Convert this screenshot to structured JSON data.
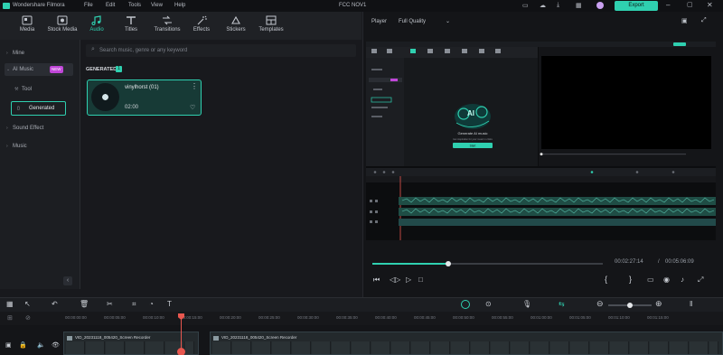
{
  "titlebar": {
    "app_name": "Wondershare Filmora",
    "menus": [
      "File",
      "Edit",
      "Tools",
      "View",
      "Help"
    ],
    "project_name": "FCC NOV1",
    "export_label": "Export"
  },
  "toolbar": {
    "tabs": [
      {
        "label": "Media",
        "icon": "media-icon"
      },
      {
        "label": "Stock Media",
        "icon": "stock-media-icon"
      },
      {
        "label": "Audio",
        "icon": "music-note-icon",
        "active": true
      },
      {
        "label": "Titles",
        "icon": "titles-icon"
      },
      {
        "label": "Transitions",
        "icon": "transitions-icon"
      },
      {
        "label": "Effects",
        "icon": "effects-icon"
      },
      {
        "label": "Stickers",
        "icon": "stickers-icon"
      },
      {
        "label": "Templates",
        "icon": "templates-icon"
      }
    ]
  },
  "sidebar": {
    "items": [
      {
        "label": "Mine"
      },
      {
        "label": "AI Music",
        "badge": "NEW"
      },
      {
        "label": "Tool"
      },
      {
        "label": "Generated"
      },
      {
        "label": "Sound Effect"
      },
      {
        "label": "Music"
      }
    ]
  },
  "search": {
    "placeholder": "Search music, genre or any keyword"
  },
  "generated": {
    "heading": "GENERATED",
    "count": "1",
    "card": {
      "title": "vinylhorst (01)",
      "duration": "02:00"
    }
  },
  "player": {
    "label": "Player",
    "quality": "Full Quality",
    "current_time": "00:02:27:14",
    "separator": "/",
    "total_time": "00:05:06:09",
    "progress": 0.33
  },
  "inner_preview": {
    "ai_title": "Generate AI music",
    "ai_sub": "Get inspiration for your music in clicks",
    "start_label": "Start"
  },
  "timeline": {
    "ruler": [
      "00:00:00:00",
      "00:00:05:00",
      "00:00:10:00",
      "00:00:15:00",
      "00:00:20:00",
      "00:00:25:00",
      "00:00:30:00",
      "00:00:35:00",
      "00:00:40:00",
      "00:00:45:00",
      "00:00:50:00",
      "00:00:55:00",
      "00:01:00:00",
      "00:01:05:00",
      "00:01:10:00",
      "00:01:15:00"
    ],
    "clip1": "VID_20231118_005420_Screen Recorder",
    "clip2": "VID_20231118_005420_Screen Recorder"
  },
  "colors": {
    "accent": "#2fd0b0",
    "playhead": "#e8574f"
  }
}
